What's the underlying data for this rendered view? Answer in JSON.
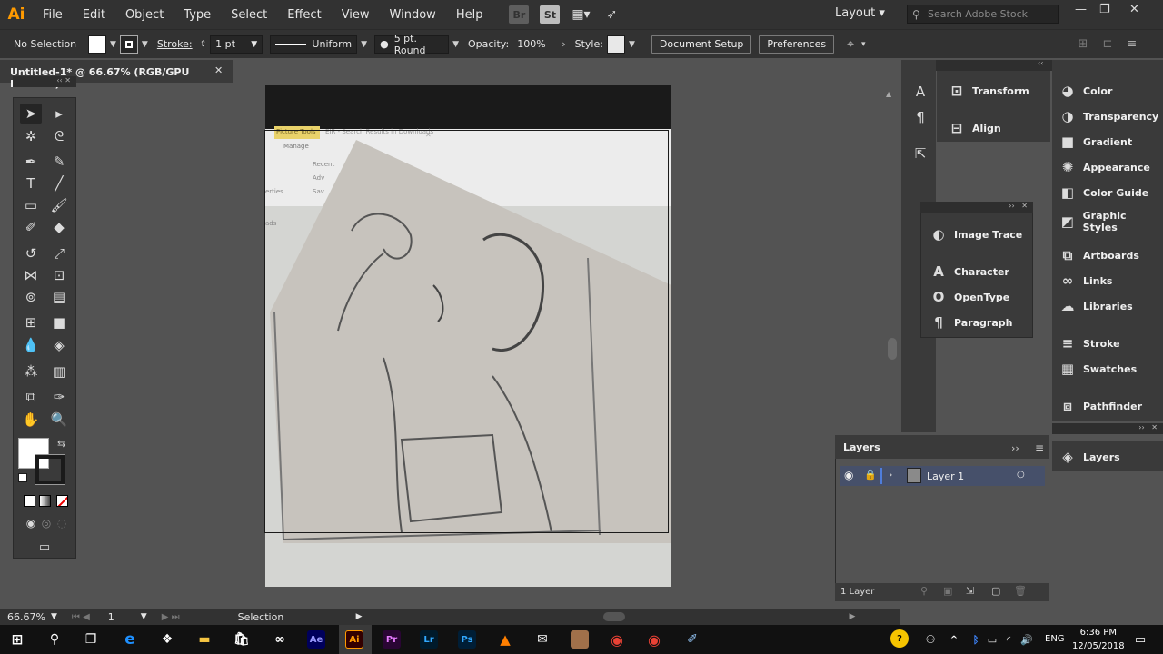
{
  "app": {
    "logo": "Ai"
  },
  "menu": [
    "File",
    "Edit",
    "Object",
    "Type",
    "Select",
    "Effect",
    "View",
    "Window",
    "Help"
  ],
  "menubar_icons": {
    "bridge": "Br",
    "stock": "St"
  },
  "workspace": "Layout",
  "search": {
    "placeholder": "Search Adobe Stock"
  },
  "control": {
    "selection": "No Selection",
    "stroke_label": "Stroke:",
    "stroke_weight": "1 pt",
    "profile": "Uniform",
    "brush": "5 pt. Round",
    "opacity_label": "Opacity:",
    "opacity": "100%",
    "style_label": "Style:",
    "document_setup": "Document Setup",
    "preferences": "Preferences"
  },
  "document": {
    "tab_title": "Untitled-1* @ 66.67% (RGB/GPU Preview)"
  },
  "embedded_image_text": {
    "picture_tools": "Picture Tools",
    "manage": "Manage",
    "search_results": "EIR - Search Results in Downloads",
    "recent": "Recent",
    "adv": "Adv",
    "save": "Sav",
    "properties": "erties",
    "ds": "ads"
  },
  "status": {
    "zoom": "66.67%",
    "artboard": "1",
    "mode": "Selection"
  },
  "panels_col2": [
    "Transform",
    "Align"
  ],
  "panels_float": [
    "Image Trace",
    "Character",
    "OpenType",
    "Paragraph"
  ],
  "panels_col3": [
    "Color",
    "Transparency",
    "Gradient",
    "Appearance",
    "Color Guide",
    "Graphic Styles",
    "Artboards",
    "Links",
    "Libraries",
    "Stroke",
    "Swatches",
    "Pathfinder"
  ],
  "layers": {
    "title": "Layers",
    "layer_name": "Layer 1",
    "count": "1 Layer",
    "side_label": "Layers"
  },
  "taskbar": {
    "icons": [
      "Ae",
      "Ai",
      "Pr",
      "Lr",
      "Ps"
    ],
    "lang": "ENG",
    "time": "6:36 PM",
    "date": "12/05/2018"
  },
  "colors": {
    "ai_orange": "#ff9a00",
    "ps_blue": "#31a8ff",
    "pr_purple": "#e77cff",
    "ae_violet": "#9999ff",
    "lr_blue": "#31a8ff"
  }
}
